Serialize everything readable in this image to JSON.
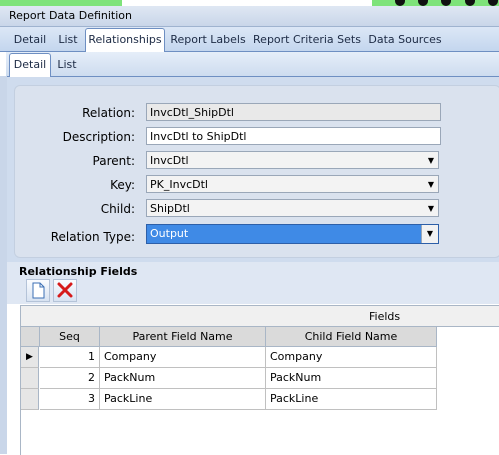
{
  "window": {
    "title": "Report Data Definition"
  },
  "tabs_main": [
    {
      "label": "Detail"
    },
    {
      "label": "List"
    },
    {
      "label": "Relationships"
    },
    {
      "label": "Report Labels"
    },
    {
      "label": "Report Criteria Sets"
    },
    {
      "label": "Data Sources"
    }
  ],
  "tabs_sub": [
    {
      "label": "Detail"
    },
    {
      "label": "List"
    }
  ],
  "form": {
    "relation": {
      "label": "Relation:",
      "value": "InvcDtl_ShipDtl"
    },
    "description": {
      "label": "Description:",
      "value": "InvcDtl to ShipDtl"
    },
    "parent": {
      "label": "Parent:",
      "value": "InvcDtl"
    },
    "key": {
      "label": "Key:",
      "value": "PK_InvcDtl"
    },
    "child": {
      "label": "Child:",
      "value": "ShipDtl"
    },
    "relation_type": {
      "label": "Relation Type:",
      "value": "Output"
    }
  },
  "relationship_fields": {
    "title": "Relationship Fields",
    "group_header": "Fields",
    "columns": [
      "Seq",
      "Parent Field Name",
      "Child Field Name"
    ],
    "rows": [
      {
        "seq": "1",
        "parent": "Company",
        "child": "Company"
      },
      {
        "seq": "2",
        "parent": "PackNum",
        "child": "PackNum"
      },
      {
        "seq": "3",
        "parent": "PackLine",
        "child": "PackLine"
      }
    ]
  },
  "icons": {
    "new": "new-document-icon",
    "delete": "delete-x-icon",
    "row_pointer": "row-pointer-icon"
  }
}
